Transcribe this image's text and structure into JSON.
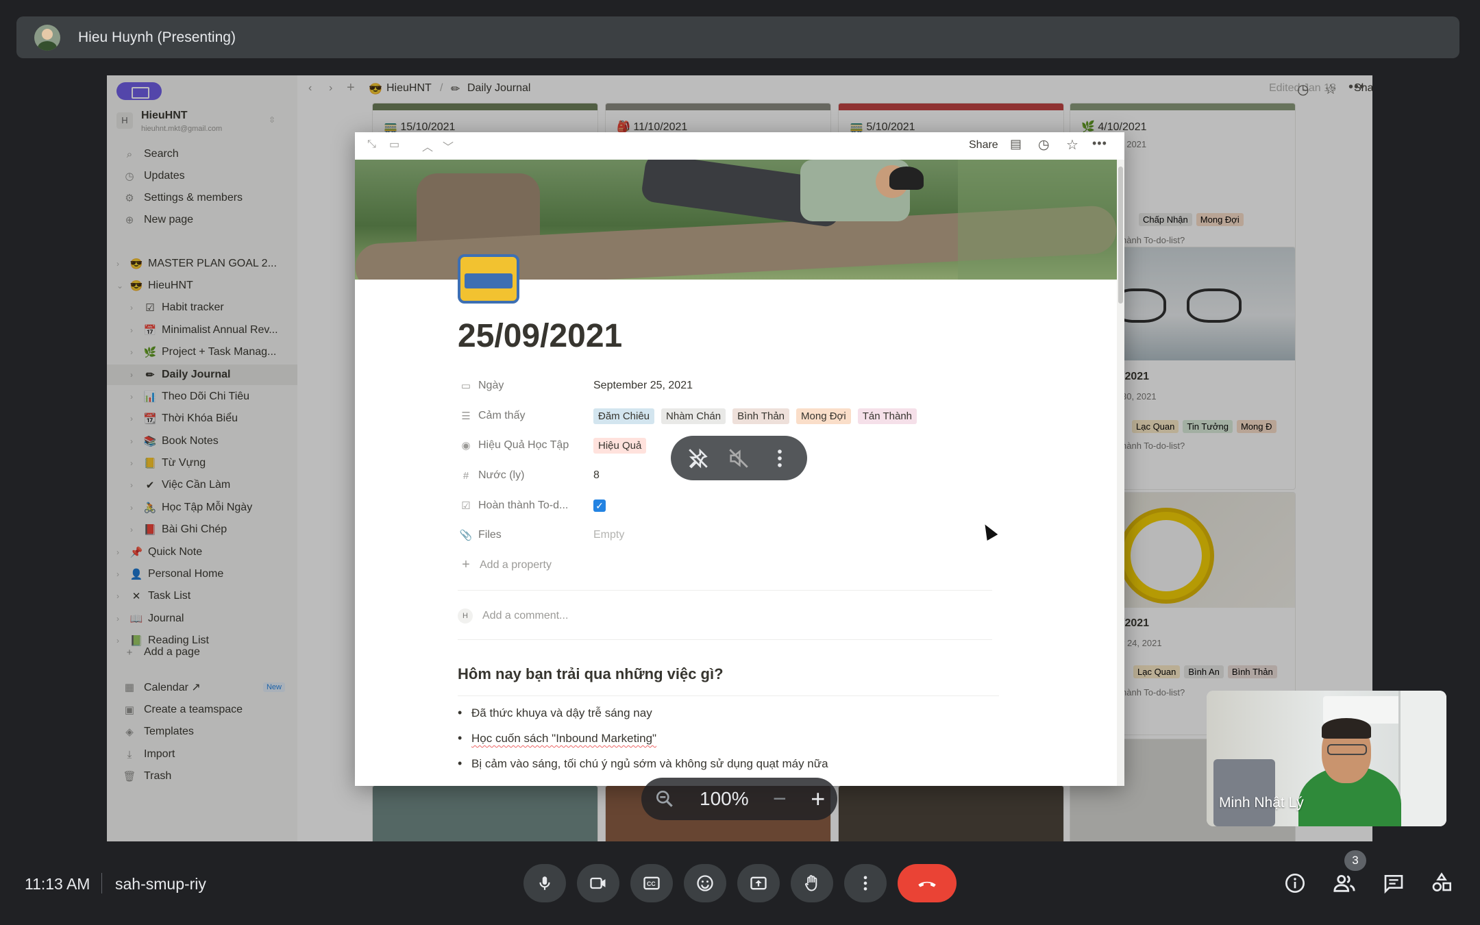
{
  "presenter": {
    "label": "Hieu Huynh (Presenting)"
  },
  "notion": {
    "topbar": {
      "breadcrumb_workspace": "HieuHNT",
      "breadcrumb_sep": "/",
      "breadcrumb_page": "Daily Journal",
      "edited": "Edited Jan 18",
      "share": "Share"
    },
    "workspace": {
      "avatar": "H",
      "name": "HieuHNT",
      "email": "hieuhnt.mkt@gmail.com"
    },
    "sidebar_actions": [
      "Search",
      "Updates",
      "Settings & members",
      "New page"
    ],
    "sidebar_pages": [
      {
        "icon": "😎",
        "label": "MASTER PLAN GOAL 2..."
      },
      {
        "icon": "😎",
        "label": "HieuHNT"
      },
      {
        "icon": "☑",
        "label": "Habit tracker"
      },
      {
        "icon": "📅",
        "label": "Minimalist Annual Rev..."
      },
      {
        "icon": "🌿",
        "label": "Project + Task Manag..."
      },
      {
        "icon": "✏",
        "label": "Daily Journal"
      },
      {
        "icon": "📊",
        "label": "Theo Dõi Chi Tiêu"
      },
      {
        "icon": "📆",
        "label": "Thời Khóa Biểu"
      },
      {
        "icon": "📚",
        "label": "Book Notes"
      },
      {
        "icon": "📒",
        "label": "Từ Vựng"
      },
      {
        "icon": "✔",
        "label": "Việc Cần Làm"
      },
      {
        "icon": "🚴",
        "label": "Học Tập Mỗi Ngày"
      },
      {
        "icon": "📕",
        "label": "Bài Ghi Chép"
      },
      {
        "icon": "📌",
        "label": "Quick Note"
      },
      {
        "icon": "👤",
        "label": "Personal Home"
      },
      {
        "icon": "✕",
        "label": "Task List"
      },
      {
        "icon": "📖",
        "label": "Journal"
      },
      {
        "icon": "📗",
        "label": "Reading List"
      }
    ],
    "add_page": "Add a page",
    "sidebar_bottom": [
      {
        "icon": "▦",
        "label": "Calendar ↗",
        "badge": "New"
      },
      {
        "icon": "▣",
        "label": "Create a teamspace"
      },
      {
        "icon": "◈",
        "label": "Templates"
      },
      {
        "icon": "⤓",
        "label": "Import"
      },
      {
        "icon": "🗑",
        "label": "Trash"
      }
    ],
    "gallery": {
      "card_dates_top": [
        "15/10/2021",
        "11/10/2021",
        "5/10/2021",
        "4/10/2021"
      ],
      "card4": {
        "date_partial": ", 2021",
        "tags": [
          "Chấp Nhận",
          "Mong Đợi"
        ],
        "todo": "hành To-do-list?"
      },
      "card5": {
        "title": "/2021",
        "date_partial": "30, 2021",
        "tags": [
          "Lạc Quan",
          "Tin Tưởng",
          "Mong Đ"
        ],
        "todo": "hành To-do-list?"
      },
      "card6": {
        "title": "/2021",
        "date_partial": "r 24, 2021",
        "tags": [
          "Lạc Quan",
          "Bình An",
          "Bình Thản"
        ],
        "todo": "hành To-do-list?"
      }
    },
    "modal": {
      "share": "Share",
      "title": "25/09/2021",
      "properties": [
        {
          "icon": "▭",
          "name": "Ngày",
          "value": "September 25, 2021"
        },
        {
          "icon": "☰",
          "name": "Cảm thấy",
          "tags": [
            {
              "label": "Đăm Chiêu",
              "color": "#d3e5ef"
            },
            {
              "label": "Nhàm Chán",
              "color": "#e9e9e7"
            },
            {
              "label": "Bình Thản",
              "color": "#eee0da"
            },
            {
              "label": "Mong Đợi",
              "color": "#fadec9"
            },
            {
              "label": "Tán Thành",
              "color": "#f5e0e9"
            }
          ]
        },
        {
          "icon": "◉",
          "name": "Hiệu Quả Học Tập",
          "tags": [
            {
              "label": "Hiệu Quả",
              "color": "#ffe2dd"
            }
          ]
        },
        {
          "icon": "#",
          "name": "Nước (ly)",
          "value": "8"
        },
        {
          "icon": "☑",
          "name": "Hoàn thành To-d...",
          "checked": true
        },
        {
          "icon": "📎",
          "name": "Files",
          "value": "Empty"
        }
      ],
      "add_property": "Add a property",
      "comment_avatar": "H",
      "comment_placeholder": "Add a comment...",
      "heading": "Hôm nay bạn trải qua những việc gì?",
      "bullets": [
        "Đã thức khuya và dậy trễ sáng nay",
        "Học cuốn sách \"Inbound Marketing\"",
        "Bị cảm vào sáng, tối chú ý ngủ sớm và không sử dụng quạt máy nữa"
      ]
    }
  },
  "zoom": {
    "level": "100%"
  },
  "self_view": {
    "name": "Minh Nhật Lý"
  },
  "meeting": {
    "time": "11:13 AM",
    "code": "sah-smup-riy",
    "participant_count": "3"
  },
  "colors": {
    "end_call": "#ea4335",
    "background": "#202124",
    "accent": "#6e5ce6"
  }
}
